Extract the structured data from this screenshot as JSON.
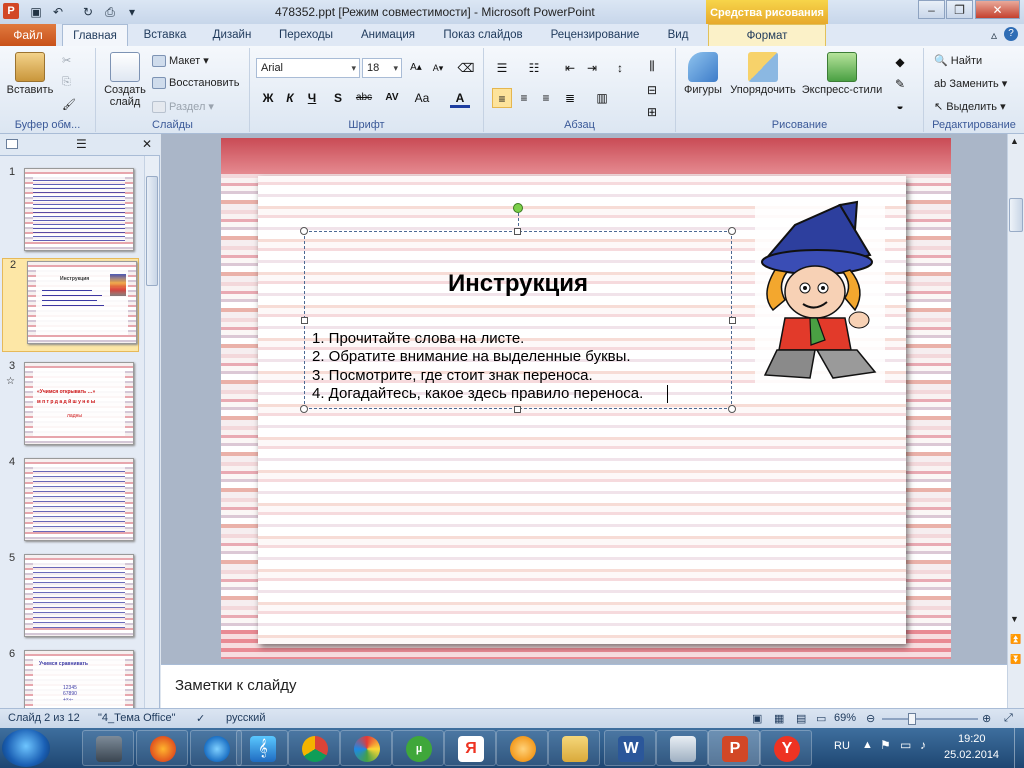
{
  "titlebar": {
    "doc_title": "478352.ppt [Режим совместимости] - Microsoft PowerPoint",
    "contextual_tab_title": "Средства рисования"
  },
  "tabs": [
    "Файл",
    "Главная",
    "Вставка",
    "Дизайн",
    "Переходы",
    "Анимация",
    "Показ слайдов",
    "Рецензирование",
    "Вид",
    "Формат"
  ],
  "ribbon": {
    "clipboard": {
      "paste": "Вставить",
      "label": "Буфер обм..."
    },
    "slides": {
      "new_slide": "Создать слайд",
      "layout": "Макет",
      "reset": "Восстановить",
      "section": "Раздел",
      "label": "Слайды"
    },
    "font": {
      "name": "Arial",
      "size": "18",
      "label": "Шрифт",
      "bold": "Ж",
      "italic": "К",
      "underline": "Ч",
      "shadow": "S",
      "strike": "abc",
      "spacing": "AV",
      "case": "Aa",
      "color": "A"
    },
    "paragraph": {
      "label": "Абзац"
    },
    "drawing": {
      "shapes": "Фигуры",
      "arrange": "Упорядочить",
      "quick_styles": "Экспресс-стили",
      "label": "Рисование"
    },
    "editing": {
      "find": "Найти",
      "replace": "Заменить",
      "select": "Выделить",
      "label": "Редактирование"
    }
  },
  "slides_panel": {
    "numbers": [
      "1",
      "2",
      "3",
      "4",
      "5",
      "6"
    ],
    "thumb3_text": [
      "«Учимся  открывать …»",
      "м п т р д а д й ш у н е ы",
      "ладны"
    ],
    "thumb2_title": "Инструкция",
    "thumb6_title": "Учимся сравнивать",
    "thumb6_digits": [
      "12345",
      "67890",
      "+×÷-"
    ]
  },
  "slide": {
    "title": "Инструкция",
    "items": [
      "1.   Прочитайте слова на листе.",
      "2. Обратите внимание на выделенные буквы.",
      "3. Посмотрите, где стоит знак переноса.",
      "4. Догадайтесь, какое здесь правило переноса."
    ]
  },
  "notes_placeholder": "Заметки к слайду",
  "statusbar": {
    "slide_info": "Слайд 2 из 12",
    "theme": "\"4_Тема Office\"",
    "language": "русский",
    "zoom": "69%"
  },
  "tray": {
    "lang": "RU",
    "time": "19:20",
    "date": "25.02.2014"
  },
  "colors": {
    "accent": "#d24726",
    "slide_band": "#c94b55",
    "file_tab": "#c8511a"
  }
}
